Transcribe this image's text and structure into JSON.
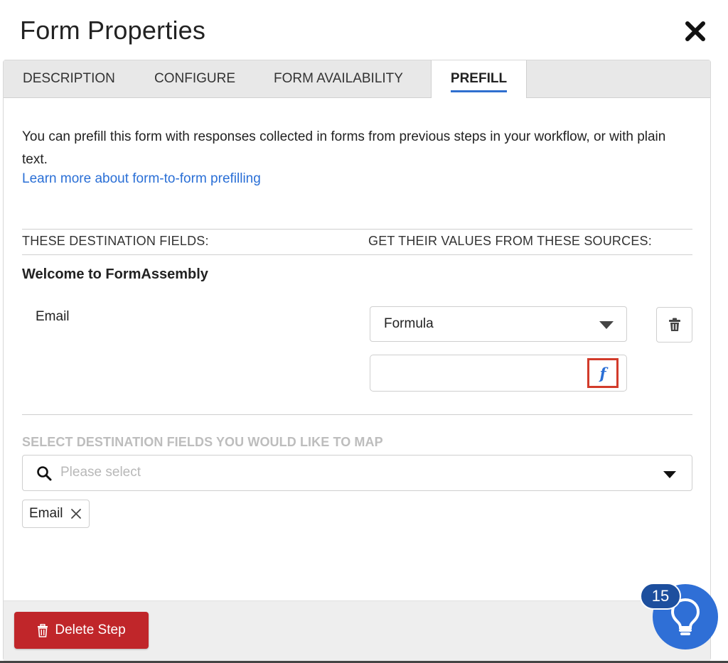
{
  "dialog": {
    "title": "Form Properties",
    "close_icon": "close-icon"
  },
  "tabs": [
    {
      "label": "DESCRIPTION",
      "active": false
    },
    {
      "label": "CONFIGURE",
      "active": false
    },
    {
      "label": "FORM AVAILABILITY",
      "active": false
    },
    {
      "label": "PREFILL",
      "active": true
    }
  ],
  "prefill": {
    "intro": "You can prefill this form with responses collected in forms from previous steps in your workflow, or with plain text.",
    "learn_more": "Learn more about form-to-form prefilling",
    "col_destination": "THESE DESTINATION FIELDS:",
    "col_source": "GET THEIR VALUES FROM THESE SOURCES:",
    "form_name": "Welcome to FormAssembly",
    "mapping": {
      "field": "Email",
      "source_type": "Formula",
      "formula_value": "",
      "fx_label": "f"
    },
    "select_heading": "SELECT DESTINATION FIELDS YOU WOULD LIKE TO MAP",
    "search_placeholder": "Please select",
    "chips": [
      {
        "label": "Email"
      }
    ]
  },
  "footer": {
    "delete_label": "Delete Step"
  },
  "help": {
    "badge_count": "15"
  },
  "colors": {
    "accent": "#2a6fd6",
    "danger": "#c0262a",
    "highlight": "#d23b2b",
    "fab": "#2f6fd6"
  }
}
